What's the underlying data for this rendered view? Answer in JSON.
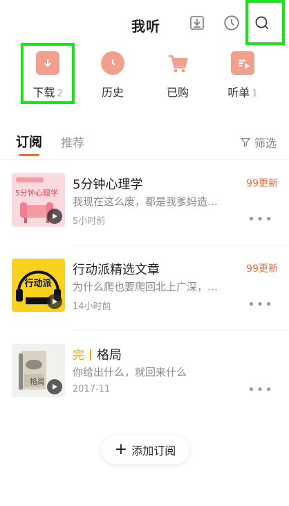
{
  "header": {
    "title": "我听",
    "icons": [
      "download-box-icon",
      "history-clock-icon",
      "search-icon"
    ]
  },
  "quick_actions": [
    {
      "label": "下载",
      "count": "2",
      "icon": "download-icon"
    },
    {
      "label": "历史",
      "count": "",
      "icon": "clock-icon"
    },
    {
      "label": "已购",
      "count": "",
      "icon": "cart-icon"
    },
    {
      "label": "听单",
      "count": "1",
      "icon": "playlist-icon"
    }
  ],
  "tabs": {
    "active": "订阅",
    "inactive": "推荐",
    "filter_label": "筛选"
  },
  "subscriptions": [
    {
      "title": "5分钟心理学",
      "description": "我现在这么废，都是我爹妈造…",
      "time": "5小时前",
      "update": "99更新",
      "cover_text": "5分钟心理学"
    },
    {
      "title": "行动派精选文章",
      "description": "为什么爬也要爬回北上广深，…",
      "time": "14小时前",
      "update": "99更新",
      "cover_text": "行动派"
    },
    {
      "title": "格局",
      "done_tag": "完",
      "description": "你给出什么，就回来什么",
      "time": "2017-11",
      "update": "",
      "cover_text": "格局"
    }
  ],
  "add_button": {
    "label": "添加订阅"
  },
  "colors": {
    "accent": "#f26b3a",
    "quick_icon": "#f0a08c",
    "highlight": "#19e619",
    "done": "#f0a020"
  }
}
